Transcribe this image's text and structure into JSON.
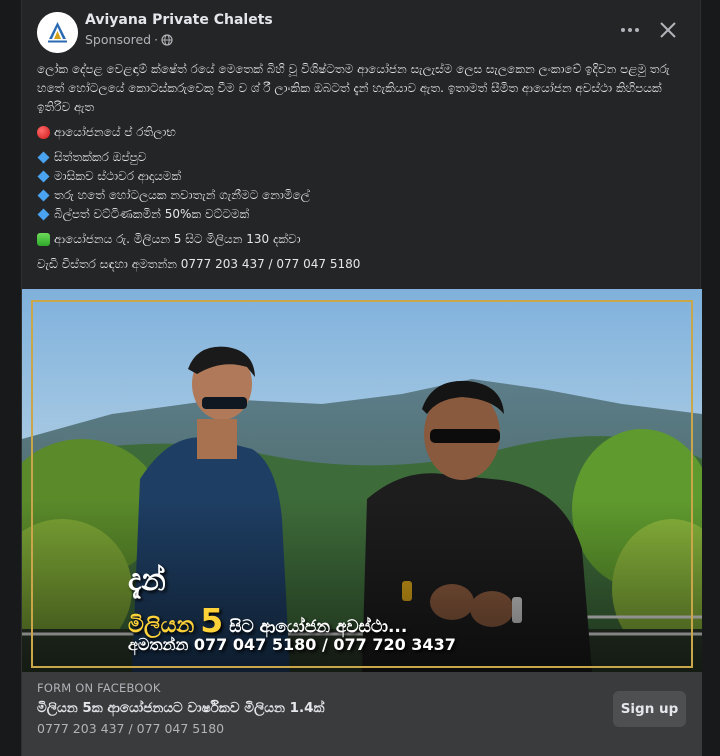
{
  "post": {
    "page_name": "Aviyana Private Chalets",
    "sponsored": "Sponsored",
    "separator": "·",
    "body": {
      "intro": "ලෝක දේපළ වෙළඳාම් ක්ෂේත් රයේ මෙතෙක් බිහි වූ විශිෂ්ටතම ආයෝජන සැලැස්ම ලෙස සැලකෙන ලංකාවේ ඉදිවන පළමු තරු හතේ හෝටලයේ කොටස්කරුවෙකු වීම ව ශ් රී ලාංකික ඔබටත් දැන් හැකියාව ඇත. ඉතාමත් සීමිත ආයෝජන අවස්ථා කිහිපයක් ඉතිරිව ඇත",
      "benefits_heading": "ආයෝජනයේ ප් රතිලාභ",
      "benefits": [
        "සිත්තක්කර ඔප්පුව",
        "මාසිකව ස්ථාවර ආදායමක්",
        "තරු හතේ හෝටලයක නවාතැන් ගැනීමට නොමිලේ",
        "බිල්පත් වට්ටිණකමින් 50%ක වට්ටමක්"
      ],
      "range_line": "ආයෝජනය රු. මිලියන 5 සිට මිලියන 130 දක්වා",
      "contact_line": "වැඩි විස්තර සඳහා අමතන්න 0777 203 437 / 077 047 5180"
    },
    "media": {
      "overlay_line1": "දැන්",
      "overlay_million": "මිලියන",
      "overlay_five": "5",
      "overlay_rest": "සිට ආයෝජන අවස්ථා...",
      "overlay_phone": "අමතන්න 077 047 5180 / 077 720 3437"
    },
    "cta": {
      "source": "FORM ON FACEBOOK",
      "headline": "මිලියන 5ක ආයෝජනයට වාර්ෂිකව මිලියන 1.4ක්",
      "description": "0777 203 437 / 077 047 5180",
      "button_label": "Sign up"
    }
  },
  "icons": {
    "more": "more-options-icon",
    "close": "close-icon",
    "globe": "globe-icon",
    "red_bullet": "red-circle-icon",
    "blue_bullet": "blue-diamond-icon",
    "green_bullet": "green-square-icon"
  },
  "colors": {
    "card_bg": "#242526",
    "cta_bg": "#3a3b3c",
    "button_bg": "#4e4f50",
    "text_primary": "#e4e6eb",
    "text_secondary": "#b0b3b8",
    "overlay_gold": "#ffd23a"
  }
}
